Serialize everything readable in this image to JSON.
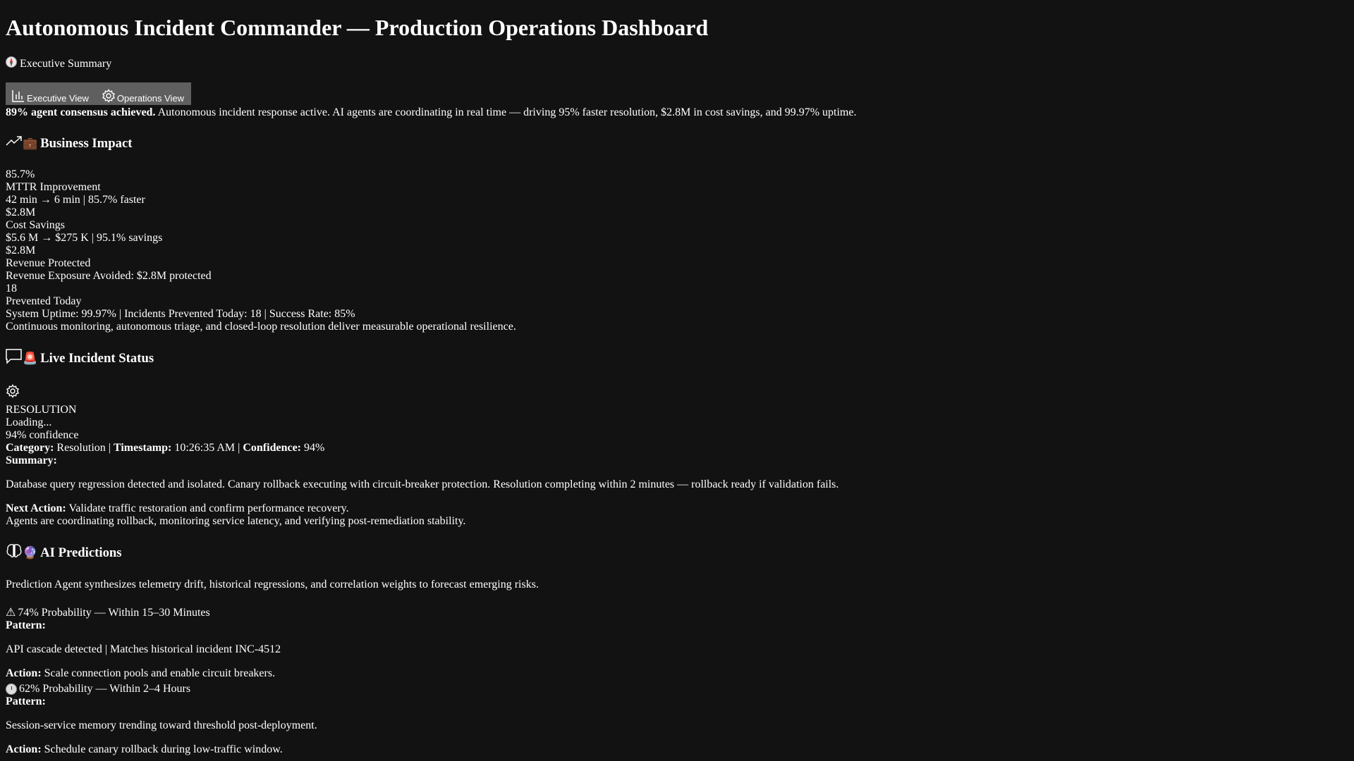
{
  "title": "Autonomous Incident Commander — Production Operations Dashboard",
  "exec_summary_label": "Executive Summary",
  "tabs": [
    {
      "label": "Executive View",
      "icon": "bar-chart-icon"
    },
    {
      "label": "Operations View",
      "icon": "gear-icon"
    }
  ],
  "consensus": {
    "bold": "89% agent consensus achieved.",
    "text": " Autonomous incident response active. AI agents are coordinating in real time — driving 95% faster resolution, $2.8M in cost savings, and 99.97% uptime."
  },
  "business_impact": {
    "emoji": "💼",
    "heading": "Business Impact",
    "metrics": [
      {
        "value": "85.7%",
        "label": "MTTR Improvement",
        "detail": "42 min → 6 min | 85.7% faster"
      },
      {
        "value": "$2.8M",
        "label": "Cost Savings",
        "detail": "$5.6 M → $275 K | 95.1% savings"
      },
      {
        "value": "$2.8M",
        "label": "Revenue Protected",
        "detail": "Revenue Exposure Avoided: $2.8M protected"
      },
      {
        "value": "18",
        "label": "Prevented Today"
      }
    ],
    "uptime_line": "System Uptime: 99.97% | Incidents Prevented Today: 18 | Success Rate: 85%",
    "footer": "Continuous monitoring, autonomous triage, and closed-loop resolution deliver measurable operational resilience."
  },
  "live_incident": {
    "emoji": "🚨",
    "heading": "Live Incident Status",
    "phase": "RESOLUTION",
    "loading": "Loading...",
    "confidence_text": "94% confidence",
    "category_label": "Category:",
    "category": " Resolution | ",
    "timestamp_label": "Timestamp:",
    "timestamp": " 10:26:35 AM | ",
    "confidence_label": "Confidence:",
    "confidence": " 94%",
    "summary_label": "Summary:",
    "summary": "Database query regression detected and isolated. Canary rollback executing with circuit-breaker protection. Resolution completing within 2 minutes — rollback ready if validation fails.",
    "next_action_label": "Next Action:",
    "next_action": " Validate traffic restoration and confirm performance recovery.",
    "coordination": "Agents are coordinating rollback, monitoring service latency, and verifying post-remediation stability."
  },
  "predictions": {
    "emoji": "🔮",
    "heading": "AI Predictions",
    "intro": "Prediction Agent synthesizes telemetry drift, historical regressions, and correlation weights to forecast emerging risks.",
    "items": [
      {
        "icon": "⚠",
        "headline": "74% Probability — Within 15–30 Minutes",
        "pattern_label": "Pattern:",
        "pattern": "API cascade detected | Matches historical incident INC-4512",
        "action_label": "Action:",
        "action": " Scale connection pools and enable circuit breakers."
      },
      {
        "icon": "clock",
        "headline": "62% Probability — Within 2–4 Hours",
        "pattern_label": "Pattern:",
        "pattern": "Session-service memory trending toward threshold post-deployment.",
        "action_label": "Action:",
        "action": " Schedule canary rollback during low-traffic window."
      }
    ]
  }
}
